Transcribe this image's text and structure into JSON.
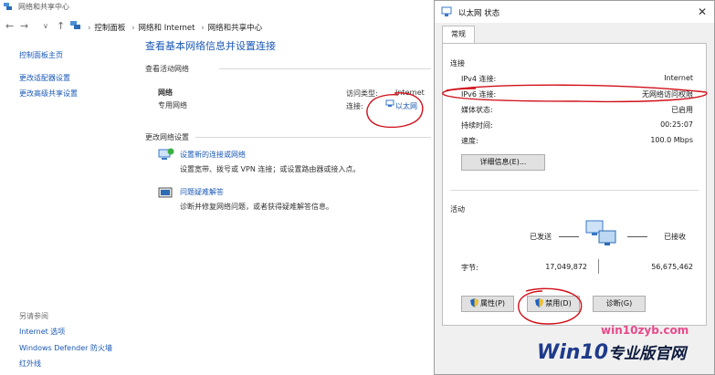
{
  "background_window": {
    "title": "网络和共享中心",
    "breadcrumb": [
      "控制面板",
      "网络和 Internet",
      "网络和共享中心"
    ],
    "sidebar": {
      "links": [
        "控制面板主页",
        "更改适配器设置",
        "更改高级共享设置"
      ],
      "see_also_label": "另请参阅",
      "see_also_links": [
        "Internet 选项",
        "Windows Defender 防火墙",
        "红外线"
      ]
    },
    "main": {
      "title": "查看基本网络信息并设置连接",
      "active_networks_label": "查看活动网络",
      "network_name": "网络",
      "network_type": "专用网络",
      "access_type_label": "访问类型:",
      "access_type_value": "Internet",
      "connections_label": "连接:",
      "connection_value": "以太网",
      "change_settings_label": "更改网络设置",
      "tasks": [
        {
          "title": "设置新的连接或网络",
          "desc": "设置宽带、拨号或 VPN 连接；或设置路由器或接入点。"
        },
        {
          "title": "问题疑难解答",
          "desc": "诊断并修复网络问题，或者获得疑难解答信息。"
        }
      ]
    }
  },
  "dialog": {
    "title": "以太网 状态",
    "tab": "常规",
    "connection_label": "连接",
    "rows": [
      {
        "label": "IPv4 连接:",
        "value": "Internet"
      },
      {
        "label": "IPv6 连接:",
        "value": "无网络访问权限"
      },
      {
        "label": "媒体状态:",
        "value": "已启用"
      },
      {
        "label": "持续时间:",
        "value": "00:25:07"
      },
      {
        "label": "速度:",
        "value": "100.0 Mbps"
      }
    ],
    "details_button": "详细信息(E)...",
    "activity_label": "活动",
    "sent_label": "已发送",
    "received_label": "已接收",
    "bytes_label": "字节:",
    "bytes_sent": "17,049,872",
    "bytes_received": "56,675,462",
    "properties_button": "属性(P)",
    "disable_button": "禁用(D)",
    "diagnose_button": "诊断(G)"
  },
  "watermark": {
    "site": "win10zyb.com",
    "brand": "Win10",
    "brand_cn": "专业版官网"
  },
  "colors": {
    "link": "#1a58b6",
    "annotation": "#d0101a",
    "accent_title": "#1a58b6"
  }
}
